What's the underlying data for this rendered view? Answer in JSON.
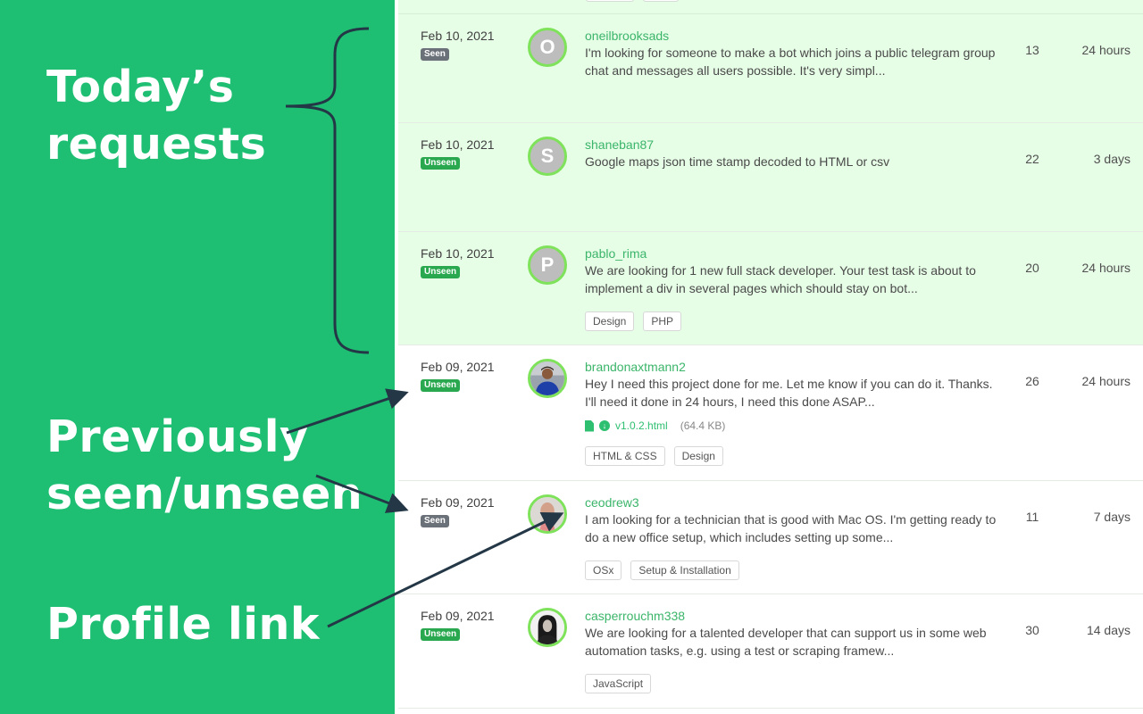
{
  "annotations": {
    "today_label_line1": "Today’s",
    "today_label_line2": "requests",
    "previous_label_line1": "Previously",
    "previous_label_line2": "seen/unseen",
    "profile_label": "Profile link"
  },
  "colors": {
    "brand_green": "#1fbf73",
    "today_row_bg": "#e6fde6",
    "username_green": "#3bb56a",
    "seen_badge": "#6b7179",
    "unseen_badge": "#2aa84f",
    "avatar_ring": "#7ee25a",
    "annotation_line": "#243746"
  },
  "requests": [
    {
      "date": "Feb 10, 2021",
      "status": "Seen",
      "avatar_initial": "O",
      "username": "oneilbrooksads",
      "description": "I'm looking for someone to make a bot which joins a public telegram group chat and messages all users possible. It's very simpl...",
      "tags": [],
      "count": "13",
      "age": "24 hours",
      "today": true
    },
    {
      "date": "Feb 10, 2021",
      "status": "Unseen",
      "avatar_initial": "S",
      "username": "shaneban87",
      "description": "Google maps json time stamp decoded to HTML or csv",
      "tags": [],
      "count": "22",
      "age": "3 days",
      "today": true
    },
    {
      "date": "Feb 10, 2021",
      "status": "Unseen",
      "avatar_initial": "P",
      "username": "pablo_rima",
      "description": "We are looking for 1 new full stack developer. Your test task is about to implement a div in several pages which should stay on bot...",
      "tags": [
        "Design",
        "PHP"
      ],
      "count": "20",
      "age": "24 hours",
      "today": true
    },
    {
      "date": "Feb 09, 2021",
      "status": "Unseen",
      "avatar_photo": "man-blue-shirt",
      "username": "brandonaxtmann2",
      "description": "Hey I need this project done for me. Let me know if you can do it. Thanks. I'll need it done in 24 hours, I need this done ASAP...",
      "attachment": {
        "name": "v1.0.2.html",
        "size": "(64.4 KB)"
      },
      "tags": [
        "HTML & CSS",
        "Design"
      ],
      "count": "26",
      "age": "24 hours",
      "today": false
    },
    {
      "date": "Feb 09, 2021",
      "status": "Seen",
      "avatar_photo": "bald-man",
      "username": "ceodrew3",
      "description": "I am looking for a technician that is good with Mac OS. I'm getting ready to do a new office setup, which includes setting up some...",
      "tags": [
        "OSx",
        "Setup & Installation"
      ],
      "count": "11",
      "age": "7 days",
      "today": false
    },
    {
      "date": "Feb 09, 2021",
      "status": "Unseen",
      "avatar_photo": "woman-dark-hair",
      "username": "casperrouchm338",
      "description": "We are looking for a talented developer that can support us in some web automation tasks, e.g. using a test or scraping framew...",
      "tags": [
        "JavaScript"
      ],
      "count": "30",
      "age": "14 days",
      "today": false
    }
  ]
}
